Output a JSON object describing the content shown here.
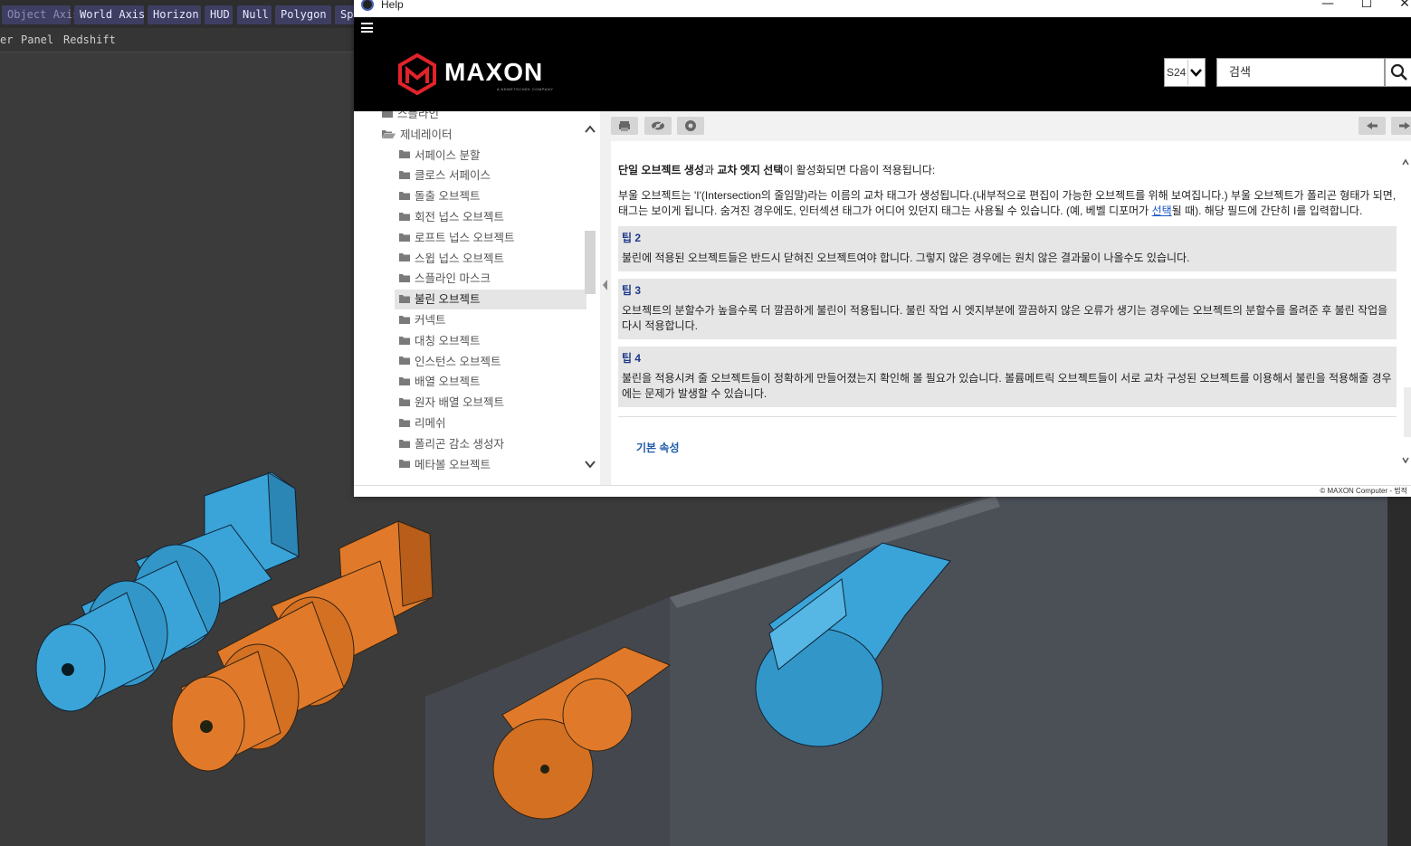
{
  "c4d": {
    "toolbar": [
      "Object Axis",
      "World Axis",
      "Horizon",
      "HUD",
      "Null",
      "Polygon",
      "Spl"
    ],
    "menubar": [
      "er",
      "Panel",
      "Redshift"
    ]
  },
  "help": {
    "window_title": "Help",
    "controls": {
      "minimize": "—",
      "maximize": "☐",
      "close": "✕"
    },
    "brand": {
      "name": "MAXON",
      "tagline": "A NEMETSCHEK COMPANY"
    },
    "version": "S24",
    "search_placeholder": "검색",
    "sidebar": {
      "items": [
        {
          "label": "스플라인",
          "level": 1,
          "open": false,
          "selected": false
        },
        {
          "label": "제네레이터",
          "level": 1,
          "open": true,
          "selected": false
        },
        {
          "label": "서페이스 분할",
          "level": 2,
          "selected": false
        },
        {
          "label": "클로스 서페이스",
          "level": 2,
          "selected": false
        },
        {
          "label": "돌출 오브젝트",
          "level": 2,
          "selected": false
        },
        {
          "label": "회전 넙스 오브젝트",
          "level": 2,
          "selected": false
        },
        {
          "label": "로프트 넙스 오브젝트",
          "level": 2,
          "selected": false
        },
        {
          "label": "스윕 넙스 오브젝트",
          "level": 2,
          "selected": false
        },
        {
          "label": "스플라인 마스크",
          "level": 2,
          "selected": false
        },
        {
          "label": "불린 오브젝트",
          "level": 2,
          "selected": true
        },
        {
          "label": "커넥트",
          "level": 2,
          "selected": false
        },
        {
          "label": "대칭 오브젝트",
          "level": 2,
          "selected": false
        },
        {
          "label": "인스턴스 오브젝트",
          "level": 2,
          "selected": false
        },
        {
          "label": "배열 오브젝트",
          "level": 2,
          "selected": false
        },
        {
          "label": "원자 배열 오브젝트",
          "level": 2,
          "selected": false
        },
        {
          "label": "리메쉬",
          "level": 2,
          "selected": false
        },
        {
          "label": "폴리곤 감소 생성자",
          "level": 2,
          "selected": false
        },
        {
          "label": "메타볼 오브젝트",
          "level": 2,
          "selected": false
        }
      ]
    },
    "content": {
      "intro_bold1": "단일 오브젝트 생성",
      "intro_mid": "과 ",
      "intro_bold2": "교차 엣지 선택",
      "intro_rest": "이 활성화되면 다음이 적용됩니다:",
      "para_before_link": "부울 오브젝트는 'I'(Intersection의 줄임말)라는 이름의 교차 태그가 생성됩니다.(내부적으로 편집이 가능한 오브젝트를 위해 보여집니다.) 부울 오브젝트가 폴리곤 형태가 되면, 태그는 보이게 됩니다. 숨겨진 경우에도, 인터섹션 태그가 어디어 있던지 태그는 사용될 수 있습니다. (예, 베벨 디포머가 ",
      "para_link": "선택",
      "para_after_link": "될 때). 해당 필드에 간단히 I를 입력합니다.",
      "tips": [
        {
          "title": "팁 2",
          "text": "불린에 적용된 오브젝트들은 반드시 닫혀진 오브젝트여야 합니다. 그렇지 않은 경우에는 원치 않은 결과물이 나올수도 있습니다."
        },
        {
          "title": "팁 3",
          "text": "오브젝트의 분할수가 높을수록 더 깔끔하게 불린이 적용됩니다. 불린 작업 시 엣지부분에 깔끔하지 않은 오류가 생기는 경우에는 오브젝트의 분할수를 올려준 후 불린 작업을 다시 적용합니다."
        },
        {
          "title": "팁 4",
          "text": "불린을 적용시켜 줄 오브젝트들이 정확하게 만들어졌는지 확인해 볼 필요가 있습니다. 볼륨메트릭 오브젝트들이 서로 교차 구성된 오브젝트를 이용해서 불린을 적용해줄 경우에는 문제가 발생할 수 있습니다."
        }
      ],
      "section_title": "기본 속성"
    },
    "footer": "© MAXON Computer - 법적"
  },
  "colors": {
    "blue_mesh": "#3aa4d8",
    "orange_mesh": "#e07a2a",
    "block": "#4b5057",
    "brand_red": "#e2232a"
  }
}
